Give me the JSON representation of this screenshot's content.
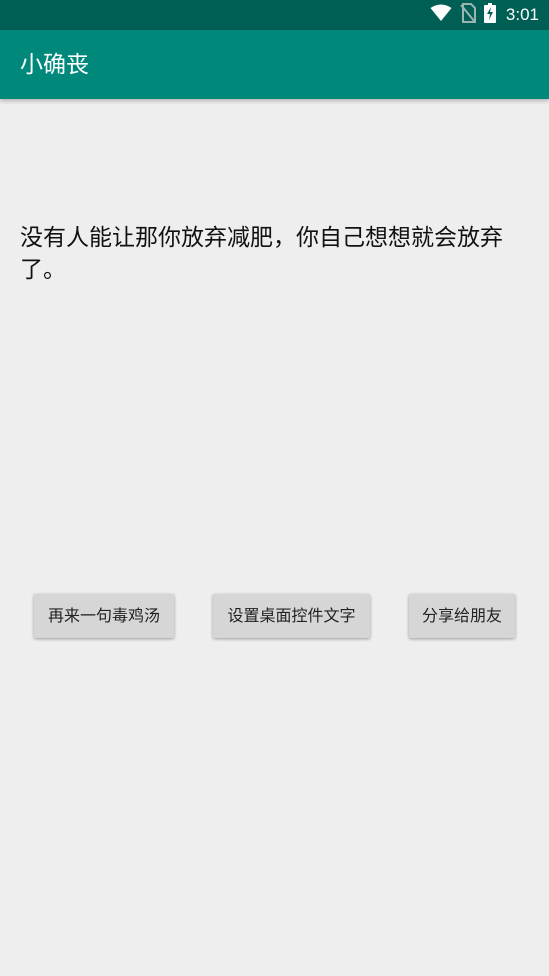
{
  "status_bar": {
    "time": "3:01",
    "icons": [
      "wifi-icon",
      "no-sim-icon",
      "battery-charging-icon"
    ]
  },
  "app_bar": {
    "title": "小确丧",
    "color": "#00897b"
  },
  "main": {
    "quote": "没有人能让那你放弃减肥，你自己想想就会放弃了。"
  },
  "buttons": [
    {
      "label": "再来一句毒鸡汤"
    },
    {
      "label": "设置桌面控件文字"
    },
    {
      "label": "分享给朋友"
    }
  ]
}
